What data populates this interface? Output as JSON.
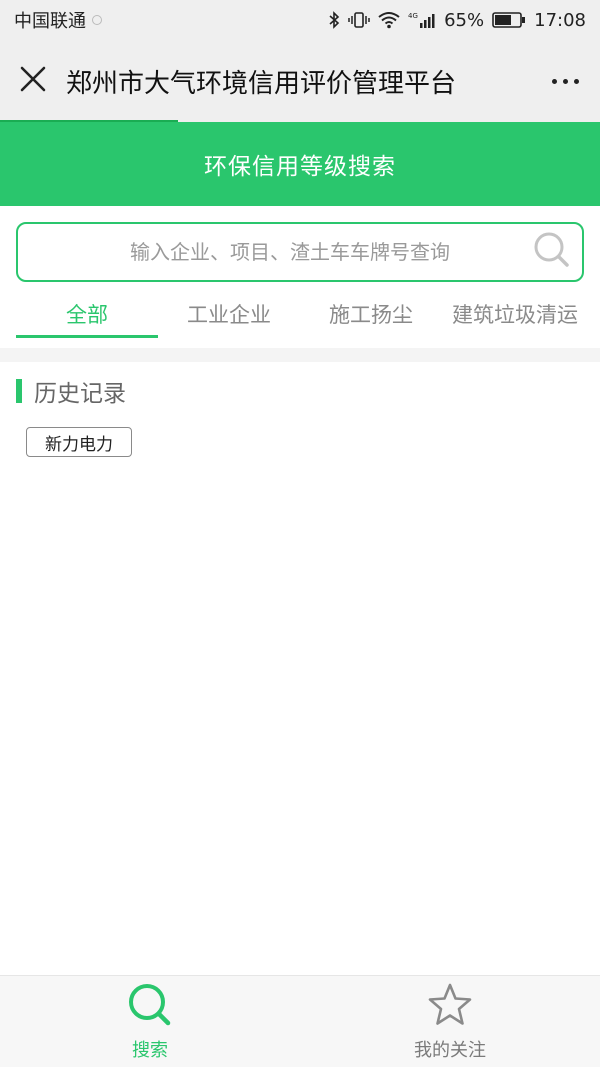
{
  "status_bar": {
    "carrier": "中国联通",
    "battery": "65%",
    "time": "17:08",
    "network": "4G"
  },
  "title_bar": {
    "title": "郑州市大气环境信用评价管理平台",
    "close_icon": "close-icon",
    "more_icon": "more-dots-icon"
  },
  "header": {
    "title": "环保信用等级搜索"
  },
  "search": {
    "placeholder": "输入企业、项目、渣土车车牌号查询",
    "value": ""
  },
  "tabs": [
    {
      "label": "全部",
      "active": true
    },
    {
      "label": "工业企业",
      "active": false
    },
    {
      "label": "施工扬尘",
      "active": false
    },
    {
      "label": "建筑垃圾清运",
      "active": false
    }
  ],
  "history": {
    "title": "历史记录",
    "items": [
      "新力电力"
    ]
  },
  "bottom_nav": {
    "items": [
      {
        "label": "搜索",
        "icon": "search-icon",
        "active": true
      },
      {
        "label": "我的关注",
        "icon": "star-icon",
        "active": false
      }
    ]
  },
  "colors": {
    "accent": "#2ac66d",
    "title_bar_bg": "#efefef"
  }
}
